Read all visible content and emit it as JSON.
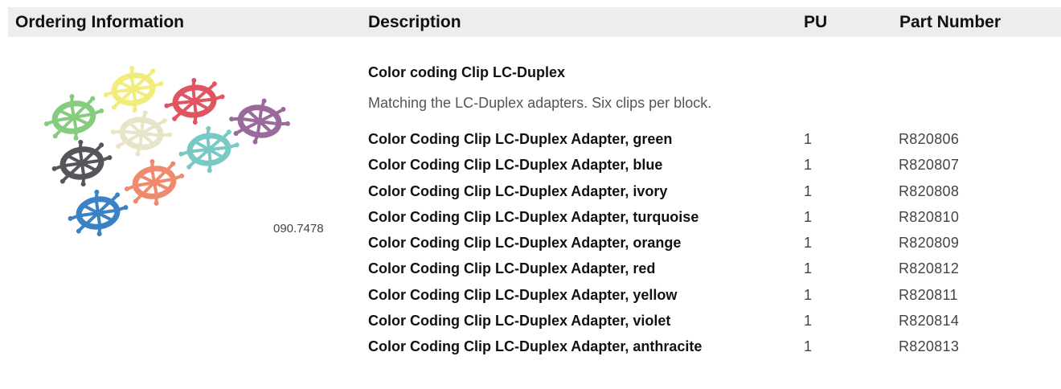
{
  "header": {
    "ordering_information": "Ordering Information",
    "description": "Description",
    "pu": "PU",
    "part_number": "Part Number"
  },
  "image": {
    "code": "090.7478",
    "clip_colors": {
      "yellow": "#f2ec7a",
      "red": "#e05561",
      "green": "#86cc7e",
      "ivory": "#e9e3c8",
      "violet": "#9a6a9c",
      "anthracite": "#55565c",
      "turquoise": "#79c9c4",
      "orange": "#ef8a6e",
      "blue": "#3a82c4"
    }
  },
  "group": {
    "title": "Color coding Clip LC-Duplex",
    "description": "Matching the LC-Duplex adapters. Six clips per block."
  },
  "rows": [
    {
      "description": "Color Coding Clip LC-Duplex Adapter, green",
      "pu": "1",
      "part_number": "R820806"
    },
    {
      "description": "Color Coding Clip LC-Duplex Adapter, blue",
      "pu": "1",
      "part_number": "R820807"
    },
    {
      "description": "Color Coding Clip LC-Duplex Adapter, ivory",
      "pu": "1",
      "part_number": "R820808"
    },
    {
      "description": "Color Coding Clip LC-Duplex Adapter, turquoise",
      "pu": "1",
      "part_number": "R820810"
    },
    {
      "description": "Color Coding Clip LC-Duplex Adapter, orange",
      "pu": "1",
      "part_number": "R820809"
    },
    {
      "description": "Color Coding Clip LC-Duplex Adapter, red",
      "pu": "1",
      "part_number": "R820812"
    },
    {
      "description": "Color Coding Clip LC-Duplex Adapter, yellow",
      "pu": "1",
      "part_number": "R820811"
    },
    {
      "description": "Color Coding Clip LC-Duplex Adapter, violet",
      "pu": "1",
      "part_number": "R820814"
    },
    {
      "description": "Color Coding Clip LC-Duplex Adapter, anthracite",
      "pu": "1",
      "part_number": "R820813"
    }
  ]
}
